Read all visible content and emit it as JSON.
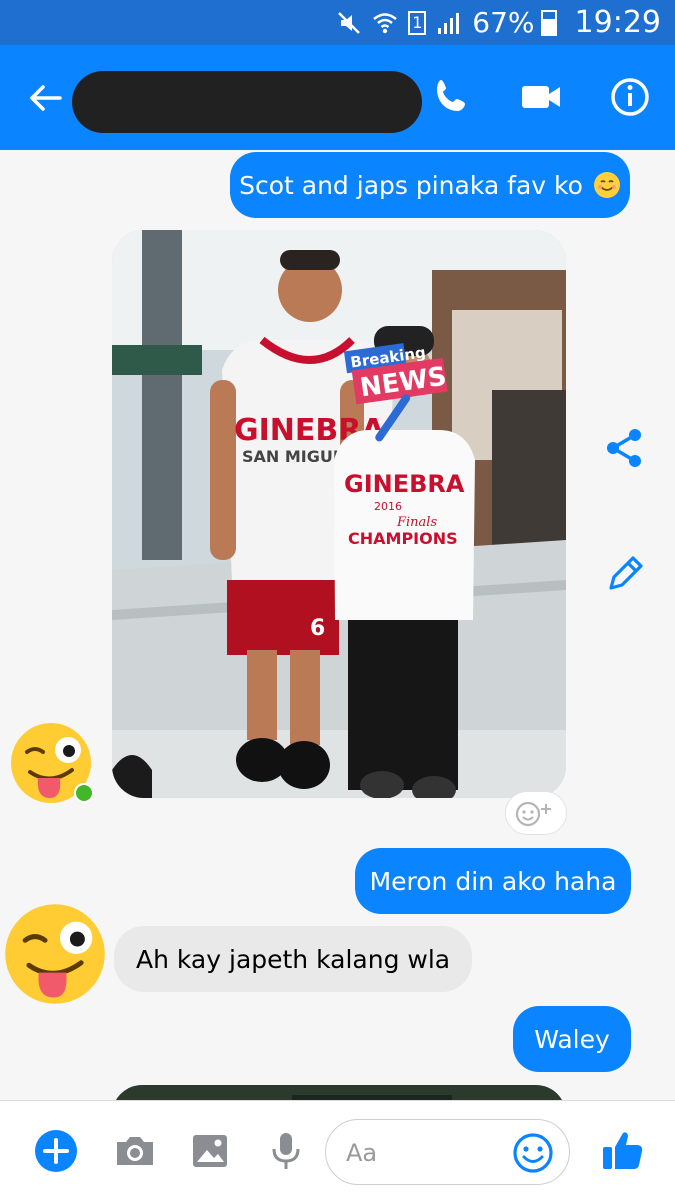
{
  "status_bar": {
    "battery_text": "67%",
    "battery_level": 0.67,
    "time": "19:29",
    "sim_label": "1",
    "icons": [
      "mute-icon",
      "wifi-icon",
      "sim-icon",
      "signal-icon",
      "battery-icon"
    ]
  },
  "header": {
    "contact_name_redacted": true,
    "icons": [
      "back-arrow-icon",
      "phone-call-icon",
      "video-call-icon",
      "info-icon"
    ]
  },
  "messages": [
    {
      "from": "me",
      "text": "Scot and japs pinaka fav ko",
      "emoji": "smiling-face-icon"
    },
    {
      "from": "them",
      "type": "photo",
      "caption_on_photo": [
        "Breaking",
        "NEWS"
      ],
      "shirt_text_1": [
        "GINEBRA",
        "SAN MIGUEL"
      ],
      "shirt_text_2": [
        "GINEBRA",
        "2016",
        "Finals",
        "CHAMPIONS"
      ],
      "shorts_number": "6"
    },
    {
      "from": "me",
      "text": "Meron din ako haha"
    },
    {
      "from": "them",
      "text": "Ah kay japeth kalang wla"
    },
    {
      "from": "me",
      "text": "Waley"
    }
  ],
  "composer": {
    "placeholder": "Aa",
    "icons": [
      "add-icon",
      "camera-icon",
      "gallery-icon",
      "microphone-icon",
      "emoji-icon",
      "like-icon"
    ]
  },
  "colors": {
    "status_bar": "#1f6fd1",
    "header": "#0a84ff",
    "bubble_out": "#0a84ff",
    "bubble_in": "#e9e9e9",
    "background": "#f6f6f6"
  }
}
